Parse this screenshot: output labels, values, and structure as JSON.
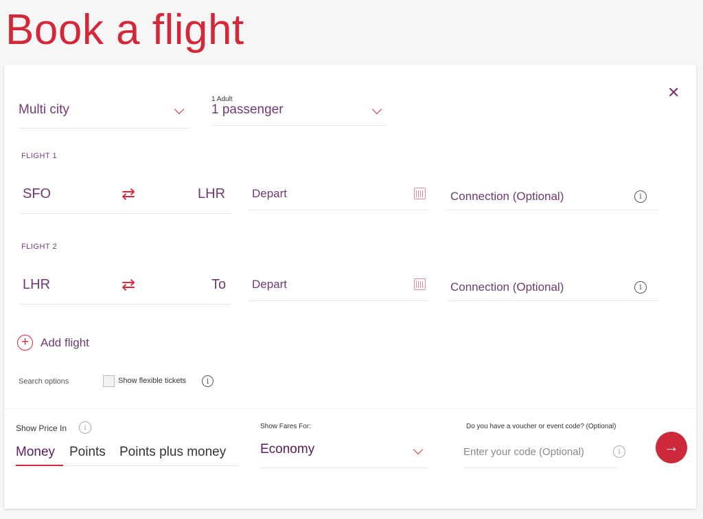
{
  "page": {
    "title": "Book a flight"
  },
  "trip_type": {
    "value": "Multi city"
  },
  "passengers": {
    "label": "1 Adult",
    "value": "1 passenger"
  },
  "flights": [
    {
      "label": "FLIGHT 1",
      "from": "SFO",
      "to": "LHR",
      "depart": "Depart",
      "connection": "Connection (Optional)"
    },
    {
      "label": "FLIGHT 2",
      "from": "LHR",
      "to": "To",
      "depart": "Depart",
      "connection": "Connection (Optional)"
    }
  ],
  "add_flight": "Add flight",
  "search_options": {
    "label": "Search options",
    "flexible": "Show flexible tickets",
    "flexible_checked": false
  },
  "price": {
    "label": "Show Price In",
    "tabs": [
      "Money",
      "Points",
      "Points plus money"
    ],
    "active": "Money"
  },
  "fares": {
    "label": "Show Fares For:",
    "value": "Economy"
  },
  "voucher": {
    "label": "Do you have a voucher or event code? (Optional)",
    "placeholder": "Enter your code (Optional)"
  },
  "colors": {
    "accent": "#d3283a",
    "text": "#6f3a72"
  }
}
